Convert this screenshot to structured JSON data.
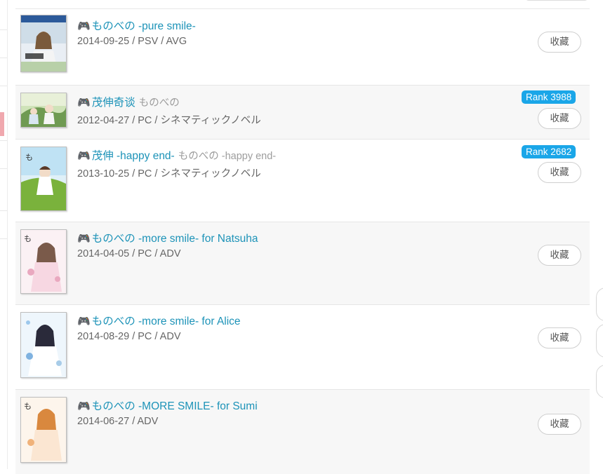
{
  "items": [
    {
      "title": "ものべの -pure smile-",
      "subtitle": "",
      "meta": "2014-09-25 / PSV / AVG",
      "rank": "",
      "fav_label": "收藏",
      "cover": "cover-image-pure-smile",
      "accent": "#2c5a9a"
    },
    {
      "title": "茂伸奇谈",
      "subtitle": "ものべの",
      "meta": "2012-04-27 / PC / シネマティックノベル",
      "rank": "Rank 3988",
      "fav_label": "收藏",
      "cover": "cover-image-monobeno",
      "accent": "#6f9a52"
    },
    {
      "title": "茂伸 -happy end-",
      "subtitle": "ものべの -happy end-",
      "meta": "2013-10-25 / PC / シネマティックノベル",
      "rank": "Rank 2682",
      "fav_label": "收藏",
      "cover": "cover-image-happy-end",
      "accent": "#7ab23c"
    },
    {
      "title": "ものべの -more smile- for Natsuha",
      "subtitle": "",
      "meta": "2014-04-05 / PC / ADV",
      "rank": "",
      "fav_label": "收藏",
      "cover": "cover-image-natsuha",
      "accent": "#d98aa6"
    },
    {
      "title": "ものべの -more smile- for Alice",
      "subtitle": "",
      "meta": "2014-08-29 / PC / ADV",
      "rank": "",
      "fav_label": "收藏",
      "cover": "cover-image-alice",
      "accent": "#7fb2e0"
    },
    {
      "title": "ものべの -MORE SMILE- for Sumi",
      "subtitle": "",
      "meta": "2014-06-27 / ADV",
      "rank": "",
      "fav_label": "收藏",
      "cover": "cover-image-sumi",
      "accent": "#e6a060"
    }
  ],
  "icons": {
    "platform": "gamepad-icon"
  },
  "colors": {
    "title_link": "#1d93b8",
    "rank_badge": "#1aa6e8"
  }
}
